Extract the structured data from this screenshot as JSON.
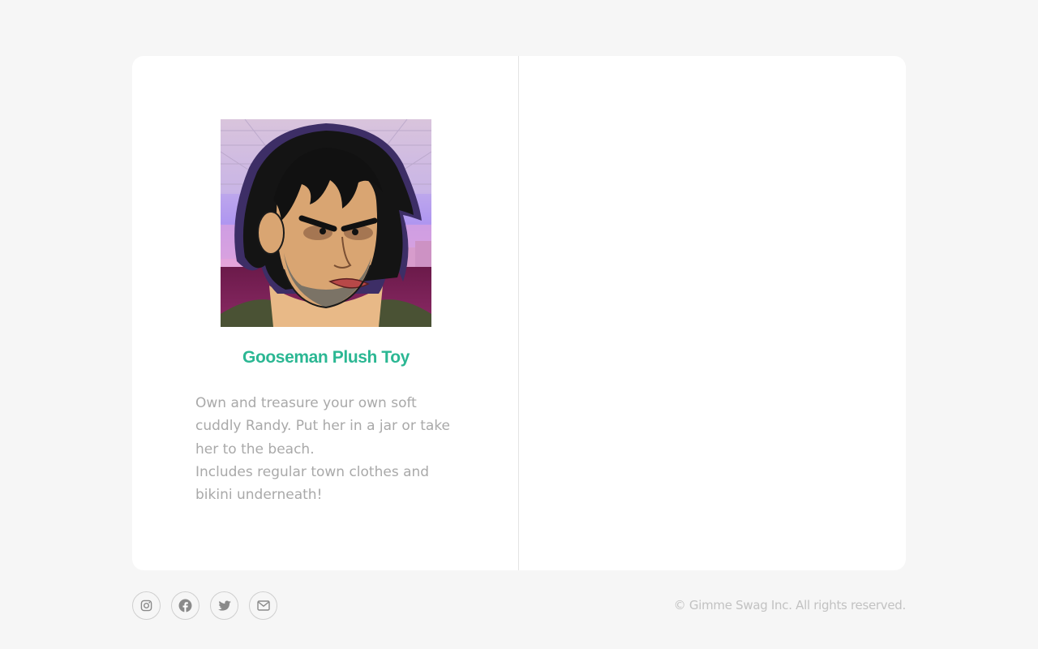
{
  "product": {
    "image_alt": "Gooseman cartoon portrait",
    "title": "Gooseman Plush Toy",
    "description": [
      "Own and treasure your own soft cuddly Randy. Put her in a jar or take her to the beach.",
      "Includes regular town clothes and bikini underneath!"
    ]
  },
  "footer": {
    "social": [
      {
        "name": "instagram",
        "icon": "instagram-icon"
      },
      {
        "name": "facebook",
        "icon": "facebook-icon"
      },
      {
        "name": "twitter",
        "icon": "twitter-icon"
      },
      {
        "name": "email",
        "icon": "envelope-icon"
      }
    ],
    "copyright": "© Gimme Swag Inc. All rights reserved."
  },
  "colors": {
    "accent": "#2bb793",
    "background": "#f6f6f6",
    "card": "#ffffff",
    "muted_text": "#a9a9a9"
  }
}
